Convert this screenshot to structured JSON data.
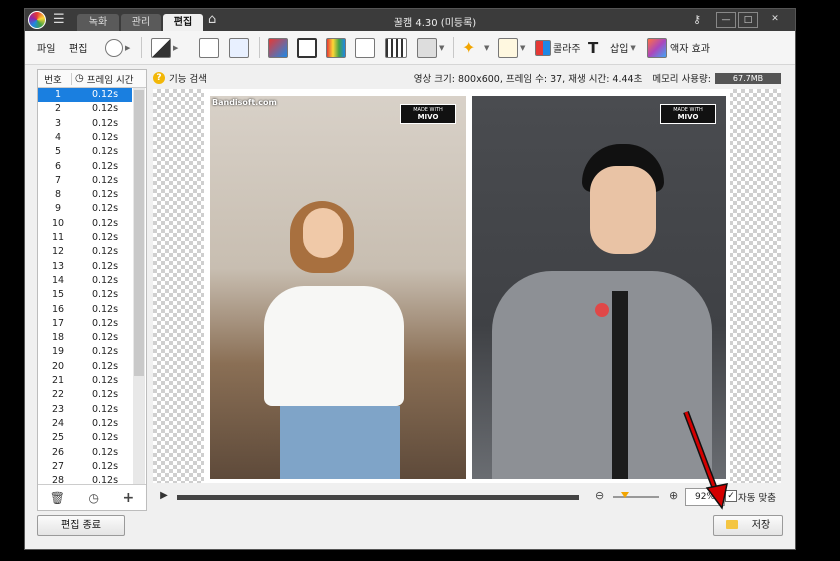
{
  "window": {
    "title": "꿀캠 4.30 (미등록)",
    "tabs": [
      {
        "label": "녹화",
        "active": false
      },
      {
        "label": "관리",
        "active": false
      },
      {
        "label": "편집",
        "active": true
      }
    ],
    "controls": {
      "min": "—",
      "max": "□",
      "close": "✕"
    }
  },
  "toolbar": {
    "file": "파일",
    "edit": "편집",
    "collage": "콜라주",
    "insert": "삽입",
    "frame_effect": "액자 효과"
  },
  "frame_list": {
    "col_number": "번호",
    "col_time": "프레임 시간",
    "rows": [
      {
        "n": "1",
        "t": "0.12s"
      },
      {
        "n": "2",
        "t": "0.12s"
      },
      {
        "n": "3",
        "t": "0.12s"
      },
      {
        "n": "4",
        "t": "0.12s"
      },
      {
        "n": "5",
        "t": "0.12s"
      },
      {
        "n": "6",
        "t": "0.12s"
      },
      {
        "n": "7",
        "t": "0.12s"
      },
      {
        "n": "8",
        "t": "0.12s"
      },
      {
        "n": "9",
        "t": "0.12s"
      },
      {
        "n": "10",
        "t": "0.12s"
      },
      {
        "n": "11",
        "t": "0.12s"
      },
      {
        "n": "12",
        "t": "0.12s"
      },
      {
        "n": "13",
        "t": "0.12s"
      },
      {
        "n": "14",
        "t": "0.12s"
      },
      {
        "n": "15",
        "t": "0.12s"
      },
      {
        "n": "16",
        "t": "0.12s"
      },
      {
        "n": "17",
        "t": "0.12s"
      },
      {
        "n": "18",
        "t": "0.12s"
      },
      {
        "n": "19",
        "t": "0.12s"
      },
      {
        "n": "20",
        "t": "0.12s"
      },
      {
        "n": "21",
        "t": "0.12s"
      },
      {
        "n": "22",
        "t": "0.12s"
      },
      {
        "n": "23",
        "t": "0.12s"
      },
      {
        "n": "24",
        "t": "0.12s"
      },
      {
        "n": "25",
        "t": "0.12s"
      },
      {
        "n": "26",
        "t": "0.12s"
      },
      {
        "n": "27",
        "t": "0.12s"
      },
      {
        "n": "28",
        "t": "0.12s"
      }
    ],
    "selected_index": 0
  },
  "info": {
    "help_label": "기능 검색",
    "details": "영상 크기: 800x600, 프레임 수: 37, 재생 시간: 4.44초",
    "memory_label": "메모리 사용량:",
    "memory_value": "67.7MB"
  },
  "preview": {
    "watermark_site": "Bandisoft.com",
    "badge_line1": "MADE WITH",
    "badge_line2": "MIVO"
  },
  "playback": {
    "zoom": "92%",
    "auto_fit": "자동 맞춤",
    "auto_fit_checked": true
  },
  "footer": {
    "exit_edit": "편집 종료",
    "save": "저장"
  },
  "colors": {
    "selection": "#1a7fe0",
    "titlebar": "#3b3b3b",
    "annotation_arrow": "#d40000"
  }
}
